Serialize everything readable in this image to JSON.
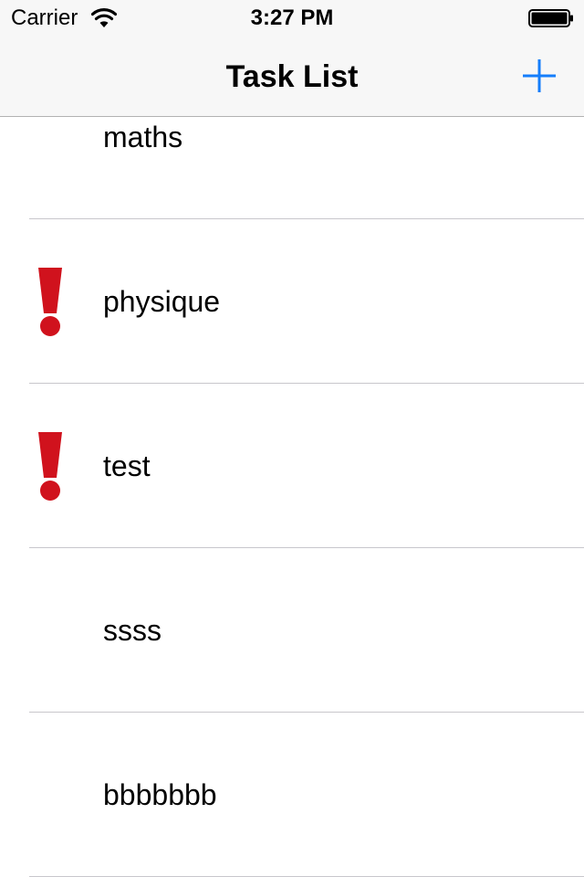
{
  "status_bar": {
    "carrier": "Carrier",
    "time": "3:27 PM"
  },
  "nav": {
    "title": "Task List",
    "add_icon": "plus-icon"
  },
  "colors": {
    "accent": "#157efb",
    "priority": "#d0121d",
    "separator": "#c8c7cc"
  },
  "tasks": [
    {
      "title": "maths",
      "important": false
    },
    {
      "title": "physique",
      "important": true
    },
    {
      "title": "test",
      "important": true
    },
    {
      "title": "ssss",
      "important": false
    },
    {
      "title": "bbbbbbb",
      "important": false
    }
  ]
}
